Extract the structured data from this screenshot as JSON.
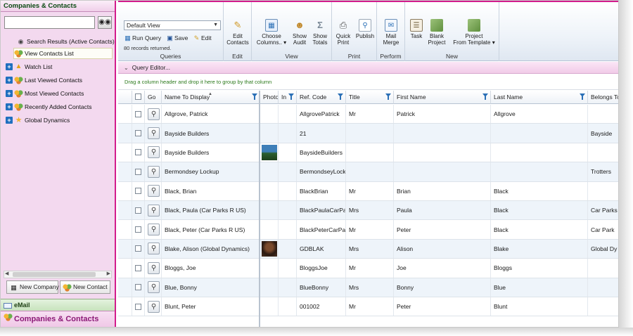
{
  "sidebar": {
    "title": "Companies & Contacts",
    "search_value": "",
    "tree": [
      {
        "label": "Search Results (Active Contacts)",
        "icon": "binoculars-icon",
        "expander": false
      },
      {
        "label": "View Contacts List",
        "icon": "people-icon",
        "expander": false,
        "selected": true
      },
      {
        "label": "Watch List",
        "icon": "bell-icon",
        "expander": true
      },
      {
        "label": "Last Viewed Contacts",
        "icon": "people-icon",
        "expander": true
      },
      {
        "label": "Most Viewed Contacts",
        "icon": "people-icon",
        "expander": true
      },
      {
        "label": "Recently Added Contacts",
        "icon": "people-icon",
        "expander": true
      },
      {
        "label": "Global Dynamics",
        "icon": "star-icon",
        "expander": true
      }
    ],
    "new_company": "New Company",
    "new_contact": "New Contact",
    "email_section": "eMail",
    "companies_section": "Companies & Contacts"
  },
  "ribbon": {
    "view_select": "Default View",
    "run_query": "Run Query",
    "save": "Save",
    "edit": "Edit",
    "records": "80 records returned.",
    "groups": {
      "queries": "Queries",
      "edit": "Edit",
      "view": "View",
      "print": "Print",
      "perform": "Perform",
      "new": "New"
    },
    "buttons": {
      "edit_contacts": [
        "Edit",
        "Contacts"
      ],
      "choose_columns": [
        "Choose",
        "Columns.. ▾"
      ],
      "show_audit": [
        "Show",
        "Audit"
      ],
      "show_totals": [
        "Show",
        "Totals"
      ],
      "quick_print": [
        "Quick",
        "Print"
      ],
      "publish": [
        "Publish",
        ""
      ],
      "mail_merge": [
        "Mail",
        "Merge"
      ],
      "task": [
        "Task",
        ""
      ],
      "blank_project": [
        "Blank",
        "Project"
      ],
      "project_template": [
        "Project",
        "From Template ▾"
      ]
    }
  },
  "query_editor": "Query Editor...",
  "group_hint": "Drag a column header and drop it here to group by that column",
  "grid": {
    "headers": {
      "go": "Go",
      "name": "Name To Display",
      "photo": "Photo",
      "in": "In",
      "ref": "Ref. Code",
      "title": "Title",
      "first": "First Name",
      "last": "Last Name",
      "belongs": "Belongs To"
    },
    "rows": [
      {
        "name": "Allgrove, Patrick",
        "photo": "",
        "ref": "AllgrovePatrick",
        "title": "Mr",
        "first": "Patrick",
        "last": "Allgrove",
        "belongs": ""
      },
      {
        "name": "Bayside Builders",
        "photo": "",
        "ref": "21",
        "title": "",
        "first": "",
        "last": "",
        "belongs": "Bayside"
      },
      {
        "name": "Bayside Builders",
        "photo": "bayside",
        "ref": "BaysideBuilders",
        "title": "",
        "first": "",
        "last": "",
        "belongs": ""
      },
      {
        "name": "Bermondsey Lockup",
        "photo": "",
        "ref": "BermondseyLock",
        "title": "",
        "first": "",
        "last": "",
        "belongs": "Trotters"
      },
      {
        "name": "Black, Brian",
        "photo": "",
        "ref": "BlackBrian",
        "title": "Mr",
        "first": "Brian",
        "last": "Black",
        "belongs": ""
      },
      {
        "name": "Black, Paula (Car Parks R US)",
        "photo": "",
        "ref": "BlackPaulaCarPa",
        "title": "Mrs",
        "first": "Paula",
        "last": "Black",
        "belongs": "Car Parks"
      },
      {
        "name": "Black, Peter (Car Parks R US)",
        "photo": "",
        "ref": "BlackPeterCarPa",
        "title": "Mr",
        "first": "Peter",
        "last": "Black",
        "belongs": "Car Park"
      },
      {
        "name": "Blake, Alison (Global Dynamics)",
        "photo": "alison",
        "ref": "GDBLAK",
        "title": "Mrs",
        "first": "Alison",
        "last": "Blake",
        "belongs": "Global Dy"
      },
      {
        "name": "Bloggs, Joe",
        "photo": "",
        "ref": "BloggsJoe",
        "title": "Mr",
        "first": "Joe",
        "last": "Bloggs",
        "belongs": ""
      },
      {
        "name": "Blue, Bonny",
        "photo": "",
        "ref": "BlueBonny",
        "title": "Mrs",
        "first": "Bonny",
        "last": "Blue",
        "belongs": ""
      },
      {
        "name": "Blunt, Peter",
        "photo": "",
        "ref": "001002",
        "title": "Mr",
        "first": "Peter",
        "last": "Blunt",
        "belongs": ""
      }
    ]
  },
  "colors": {
    "accent": "#d21c8c",
    "sidebar_bg": "#f3d9ef",
    "alt_row": "#eef4fa"
  }
}
